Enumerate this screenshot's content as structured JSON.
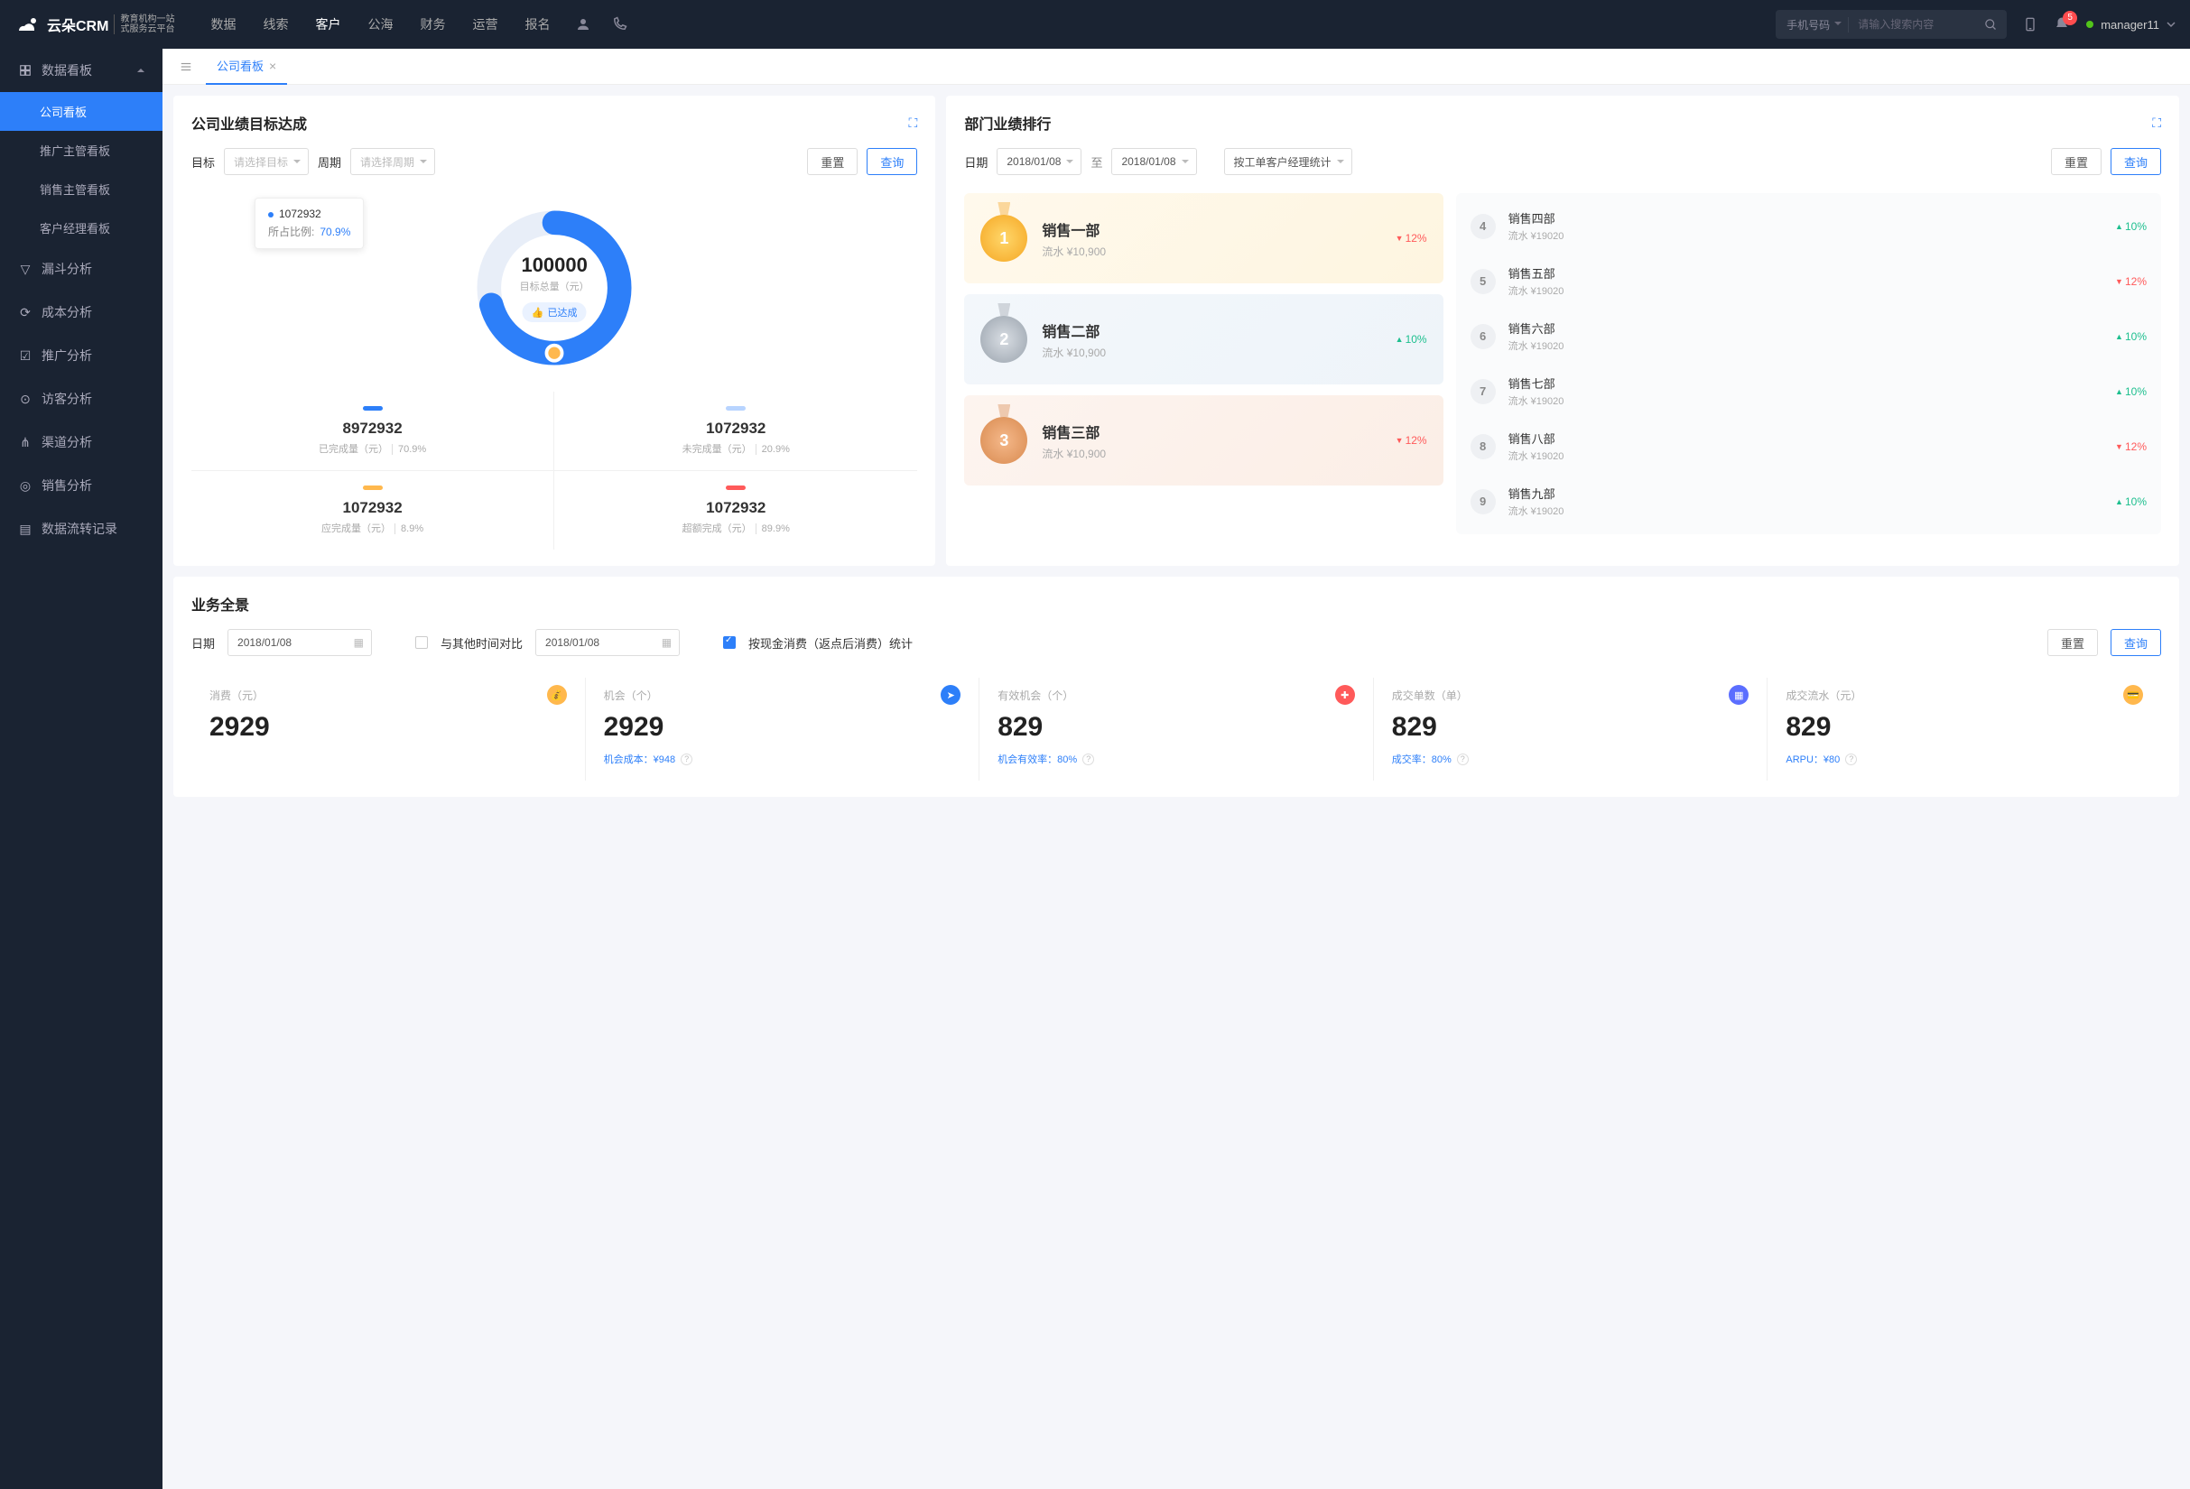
{
  "header": {
    "logo_text": "云朵CRM",
    "logo_sub1": "教育机构一站",
    "logo_sub2": "式服务云平台",
    "nav": [
      "数据",
      "线索",
      "客户",
      "公海",
      "财务",
      "运营",
      "报名"
    ],
    "active_nav": "客户",
    "search_type": "手机号码",
    "search_placeholder": "请输入搜索内容",
    "notif_count": "5",
    "username": "manager11"
  },
  "sidebar": {
    "group1": "数据看板",
    "subs": [
      "公司看板",
      "推广主管看板",
      "销售主管看板",
      "客户经理看板"
    ],
    "active_sub": "公司看板",
    "items": [
      "漏斗分析",
      "成本分析",
      "推广分析",
      "访客分析",
      "渠道分析",
      "销售分析",
      "数据流转记录"
    ]
  },
  "tabs": {
    "active": "公司看板"
  },
  "target": {
    "title": "公司业绩目标达成",
    "lbl_target": "目标",
    "sel_target": "请选择目标",
    "lbl_period": "周期",
    "sel_period": "请选择周期",
    "btn_reset": "重置",
    "btn_query": "查询",
    "center_val": "100000",
    "center_lbl": "目标总量（元）",
    "center_badge": "已达成",
    "tooltip_val": "1072932",
    "tooltip_lbl": "所占比例:",
    "tooltip_pct": "70.9%",
    "metrics": [
      {
        "color": "#2d7ff9",
        "val": "8972932",
        "lbl": "已完成量（元）",
        "pct": "70.9%"
      },
      {
        "color": "#b8d4ff",
        "val": "1072932",
        "lbl": "未完成量（元）",
        "pct": "20.9%"
      },
      {
        "color": "#ffb84d",
        "val": "1072932",
        "lbl": "应完成量（元）",
        "pct": "8.9%"
      },
      {
        "color": "#ff5a5a",
        "val": "1072932",
        "lbl": "超额完成（元）",
        "pct": "89.9%"
      }
    ]
  },
  "ranking": {
    "title": "部门业绩排行",
    "lbl_date": "日期",
    "date_from": "2018/01/08",
    "date_sep": "至",
    "date_to": "2018/01/08",
    "stat_by": "按工单客户经理统计",
    "btn_reset": "重置",
    "btn_query": "查询",
    "top3": [
      {
        "rank": "1",
        "name": "销售一部",
        "sub": "流水 ¥10,900",
        "pct": "12%",
        "dir": "down"
      },
      {
        "rank": "2",
        "name": "销售二部",
        "sub": "流水 ¥10,900",
        "pct": "10%",
        "dir": "up"
      },
      {
        "rank": "3",
        "name": "销售三部",
        "sub": "流水 ¥10,900",
        "pct": "12%",
        "dir": "down"
      }
    ],
    "rest": [
      {
        "rank": "4",
        "name": "销售四部",
        "sub": "流水 ¥19020",
        "pct": "10%",
        "dir": "up"
      },
      {
        "rank": "5",
        "name": "销售五部",
        "sub": "流水 ¥19020",
        "pct": "12%",
        "dir": "down"
      },
      {
        "rank": "6",
        "name": "销售六部",
        "sub": "流水 ¥19020",
        "pct": "10%",
        "dir": "up"
      },
      {
        "rank": "7",
        "name": "销售七部",
        "sub": "流水 ¥19020",
        "pct": "10%",
        "dir": "up"
      },
      {
        "rank": "8",
        "name": "销售八部",
        "sub": "流水 ¥19020",
        "pct": "12%",
        "dir": "down"
      },
      {
        "rank": "9",
        "name": "销售九部",
        "sub": "流水 ¥19020",
        "pct": "10%",
        "dir": "up"
      }
    ]
  },
  "overview": {
    "title": "业务全景",
    "lbl_date": "日期",
    "date1": "2018/01/08",
    "chk1_label": "与其他时间对比",
    "date2": "2018/01/08",
    "chk2_label": "按现金消费（返点后消费）统计",
    "btn_reset": "重置",
    "btn_query": "查询",
    "kpis": [
      {
        "lbl": "消费（元）",
        "val": "2929",
        "icon_color": "#ffb84d",
        "sub": ""
      },
      {
        "lbl": "机会（个）",
        "val": "2929",
        "icon_color": "#2d7ff9",
        "sub": "机会成本：¥948"
      },
      {
        "lbl": "有效机会（个）",
        "val": "829",
        "icon_color": "#ff5a5a",
        "sub": "机会有效率：80%"
      },
      {
        "lbl": "成交单数（单）",
        "val": "829",
        "icon_color": "#5b6eff",
        "sub": "成交率：80%"
      },
      {
        "lbl": "成交流水（元）",
        "val": "829",
        "icon_color": "#ffb84d",
        "sub": "ARPU：¥80"
      }
    ]
  },
  "chart_data": {
    "type": "pie",
    "title": "公司业绩目标达成",
    "total_label": "目标总量（元）",
    "total": 100000,
    "series": [
      {
        "name": "已完成量（元）",
        "value": 8972932,
        "pct": 70.9,
        "color": "#2d7ff9"
      },
      {
        "name": "未完成量（元）",
        "value": 1072932,
        "pct": 20.9,
        "color": "#b8d4ff"
      },
      {
        "name": "应完成量（元）",
        "value": 1072932,
        "pct": 8.9,
        "color": "#ffb84d"
      },
      {
        "name": "超额完成（元）",
        "value": 1072932,
        "pct": 89.9,
        "color": "#ff5a5a"
      }
    ]
  }
}
